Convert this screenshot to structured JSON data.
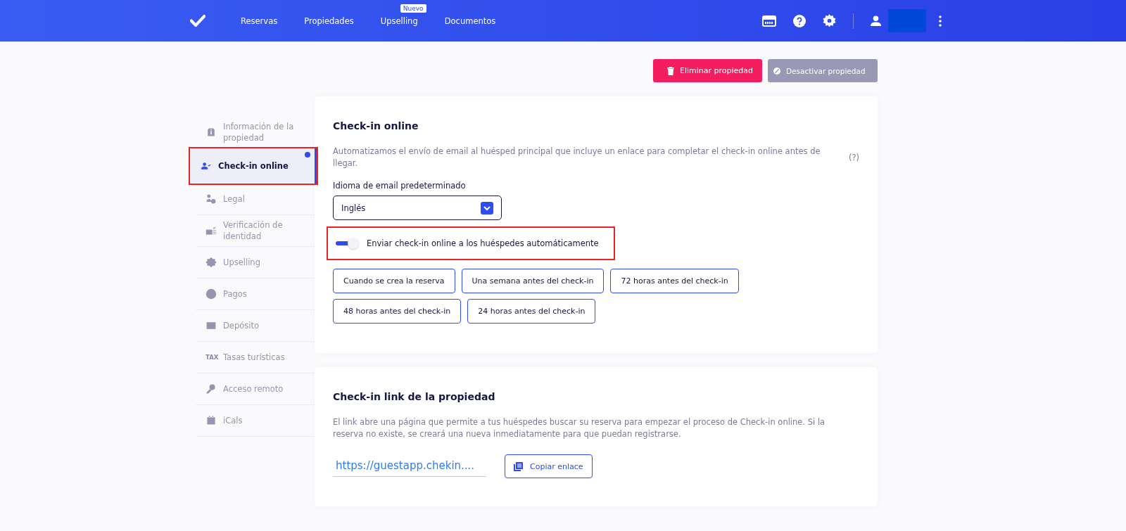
{
  "nav": {
    "items": [
      {
        "label": "Reservas"
      },
      {
        "label": "Propiedades"
      },
      {
        "label": "Upselling",
        "badge": "Nuevo"
      },
      {
        "label": "Documentos"
      }
    ]
  },
  "actions": [
    {
      "label": "Eliminar propiedad",
      "kind": "danger"
    },
    {
      "label": "Desactivar propiedad",
      "kind": "muted"
    }
  ],
  "sidebar": {
    "items": [
      {
        "label": "Información de la propiedad",
        "selected": false,
        "highlighted": false
      },
      {
        "label": "Check-in online",
        "selected": true,
        "highlighted": true
      },
      {
        "label": "Legal",
        "selected": false,
        "highlighted": false
      },
      {
        "label": "Verificación de identidad",
        "selected": false,
        "highlighted": false
      },
      {
        "label": "Upselling",
        "selected": false,
        "highlighted": false
      },
      {
        "label": "Pagos",
        "selected": false,
        "highlighted": false
      },
      {
        "label": "Depósito",
        "selected": false,
        "highlighted": false
      },
      {
        "label": "Tasas turísticas",
        "selected": false,
        "highlighted": false,
        "icon_text": "TAX"
      },
      {
        "label": "Acceso remoto",
        "selected": false,
        "highlighted": false
      },
      {
        "label": "iCals",
        "selected": false,
        "highlighted": false
      }
    ]
  },
  "checkin_card": {
    "title": "Check-in online",
    "description": "Automatizamos el envío de email al huésped principal que incluye un enlace para completar el check-in online antes de llegar.",
    "help": "(?)",
    "language_label": "Idioma de email predeterminado",
    "language_value": "Inglés",
    "toggle": {
      "label": "Enviar check-in online a los huéspedes automáticamente",
      "on": true,
      "highlighted": true
    },
    "options": [
      "Cuando se crea la reserva",
      "Una semana antes del check-in",
      "72 horas antes del check-in",
      "48 horas antes del check-in",
      "24 horas antes del check-in"
    ]
  },
  "link_card": {
    "title": "Check-in link de la propiedad",
    "description": "El link abre una página que permite a tus huéspedes buscar su reserva para empezar el proceso de Check-in online. Si la reserva no existe, se creará una nueva inmediatamente para que puedan registrarse.",
    "link": "https://guestapp.chekin....",
    "copy_button": "Copiar enlace"
  }
}
